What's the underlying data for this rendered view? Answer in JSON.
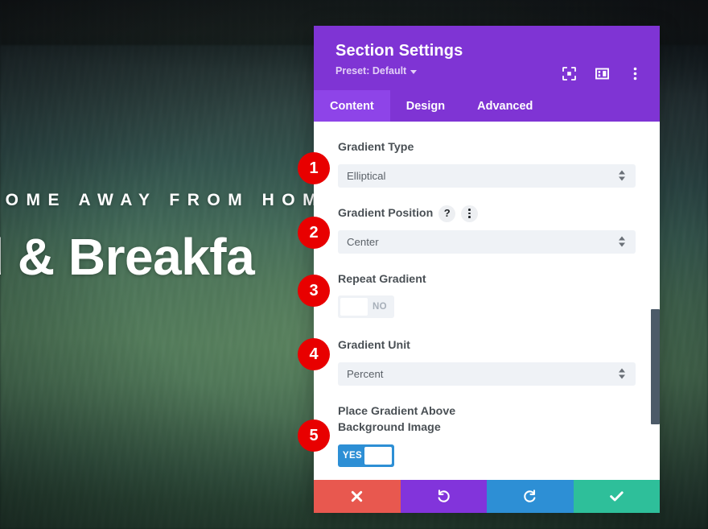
{
  "background": {
    "hero_eyebrow": "HOME AWAY FROM HOME",
    "hero_title": "d & Breakfa",
    "overlay_color": "#4a7a5a"
  },
  "panel": {
    "title": "Section Settings",
    "preset_label": "Preset: Default",
    "accent_color": "#7f34d4",
    "header_icons": [
      {
        "name": "fullscreen-icon",
        "label": "Fullscreen"
      },
      {
        "name": "layout-icon",
        "label": "Change Layout"
      },
      {
        "name": "more-options-icon",
        "label": "More Options"
      }
    ],
    "tabs": [
      {
        "label": "Content",
        "active": true
      },
      {
        "label": "Design",
        "active": false
      },
      {
        "label": "Advanced",
        "active": false
      }
    ],
    "fields": [
      {
        "id": "gradient-type",
        "label": "Gradient Type",
        "control": "select",
        "value": "Elliptical",
        "badge": "1"
      },
      {
        "id": "gradient-position",
        "label": "Gradient Position",
        "control": "select",
        "value": "Center",
        "badge": "2",
        "help_icon": "?",
        "options_icon": "more-options-icon"
      },
      {
        "id": "repeat-gradient",
        "label": "Repeat Gradient",
        "control": "toggle",
        "value": "NO",
        "state": "off",
        "badge": "3"
      },
      {
        "id": "gradient-unit",
        "label": "Gradient Unit",
        "control": "select",
        "value": "Percent",
        "badge": "4"
      },
      {
        "id": "place-gradient-above-background-image",
        "label": "Place Gradient Above Background Image",
        "control": "toggle",
        "value": "YES",
        "state": "on",
        "badge": "5"
      }
    ],
    "footer_buttons": [
      {
        "name": "cancel-button",
        "icon": "close-icon",
        "color": "#e8584f"
      },
      {
        "name": "undo-button",
        "icon": "undo-icon",
        "color": "#8234db"
      },
      {
        "name": "redo-button",
        "icon": "redo-icon",
        "color": "#2d8fd5"
      },
      {
        "name": "save-button",
        "icon": "check-icon",
        "color": "#2ebf9a"
      }
    ]
  },
  "badges": [
    "1",
    "2",
    "3",
    "4",
    "5"
  ]
}
